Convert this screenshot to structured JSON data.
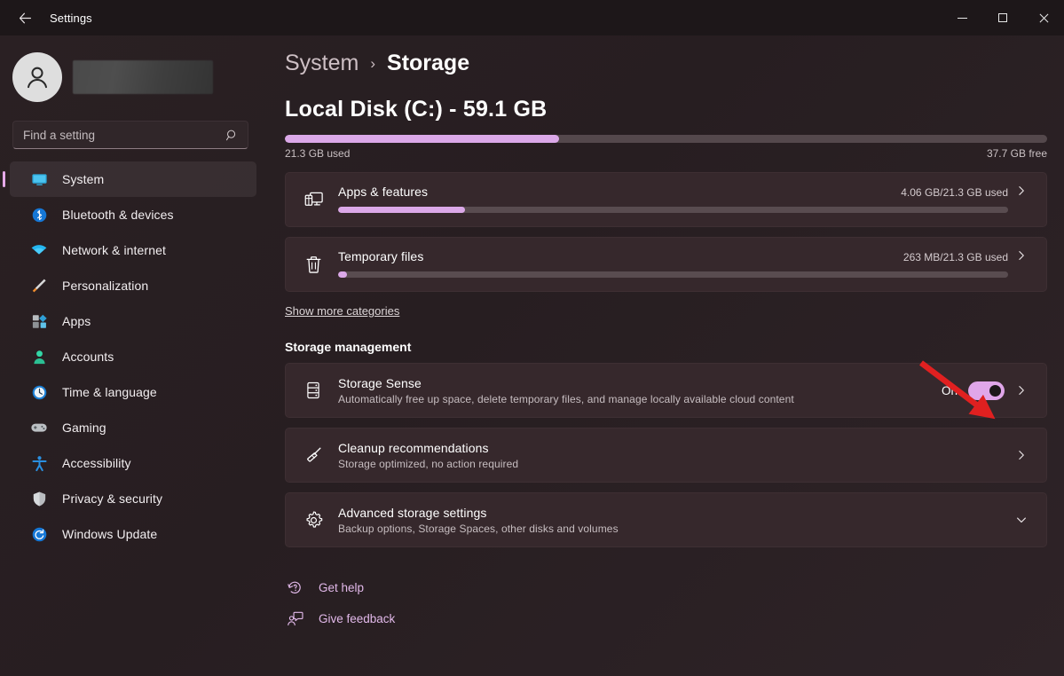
{
  "titlebar": {
    "back_label": "back-arrow",
    "title": "Settings",
    "minimize": "Minimize",
    "maximize": "Maximize",
    "close": "Close"
  },
  "sidebar": {
    "account_name_redacted": "",
    "search": {
      "placeholder": "Find a setting",
      "value": ""
    },
    "items": [
      {
        "label": "System",
        "icon": "monitor-icon",
        "selected": true
      },
      {
        "label": "Bluetooth & devices",
        "icon": "bluetooth-icon",
        "selected": false
      },
      {
        "label": "Network & internet",
        "icon": "wifi-icon",
        "selected": false
      },
      {
        "label": "Personalization",
        "icon": "paintbrush-icon",
        "selected": false
      },
      {
        "label": "Apps",
        "icon": "apps-icon",
        "selected": false
      },
      {
        "label": "Accounts",
        "icon": "person-icon",
        "selected": false
      },
      {
        "label": "Time & language",
        "icon": "clock-icon",
        "selected": false
      },
      {
        "label": "Gaming",
        "icon": "gamepad-icon",
        "selected": false
      },
      {
        "label": "Accessibility",
        "icon": "accessibility-icon",
        "selected": false
      },
      {
        "label": "Privacy & security",
        "icon": "shield-icon",
        "selected": false
      },
      {
        "label": "Windows Update",
        "icon": "update-icon",
        "selected": false
      }
    ]
  },
  "main": {
    "breadcrumb": {
      "parent": "System",
      "separator": "›",
      "current": "Storage"
    },
    "disk": {
      "title": "Local Disk (C:) - 59.1 GB",
      "used_percent": 36,
      "used_label": "21.3 GB used",
      "free_label": "37.7 GB free"
    },
    "categories": [
      {
        "title": "Apps & features",
        "usage": "4.06 GB/21.3 GB used",
        "percent": 19,
        "icon": "apps-features-icon",
        "chevron": "chevron-right-icon"
      },
      {
        "title": "Temporary files",
        "usage": "263 MB/21.3 GB used",
        "percent": 1.3,
        "icon": "trash-icon",
        "chevron": "chevron-right-icon"
      }
    ],
    "show_more_label": "Show more categories",
    "management": {
      "section_title": "Storage management",
      "items": [
        {
          "title": "Storage Sense",
          "subtitle": "Automatically free up space, delete temporary files, and manage locally available cloud content",
          "icon": "storage-drive-icon",
          "toggle_label": "On",
          "toggle_on": true,
          "chevron": "chevron-right-icon"
        },
        {
          "title": "Cleanup recommendations",
          "subtitle": "Storage optimized, no action required",
          "icon": "broom-icon",
          "toggle_label": "",
          "toggle_on": null,
          "chevron": "chevron-right-icon"
        },
        {
          "title": "Advanced storage settings",
          "subtitle": "Backup options, Storage Spaces, other disks and volumes",
          "icon": "gear-icon",
          "toggle_label": "",
          "toggle_on": null,
          "chevron": "chevron-down-icon"
        }
      ]
    },
    "footer_links": [
      {
        "label": "Get help",
        "icon": "help-question-icon"
      },
      {
        "label": "Give feedback",
        "icon": "feedback-person-icon"
      }
    ]
  },
  "annotation": {
    "arrow_color": "#e02020",
    "points_to": "Storage Sense toggle"
  },
  "colors": {
    "accent": "#e5a9e8",
    "progress_fill": "#dba8e8",
    "progress_track": "#54484c",
    "card_bg": "#36282c",
    "page_bg": "#271e21",
    "titlebar_bg": "#1d1719",
    "link": "#e2b9ea"
  }
}
